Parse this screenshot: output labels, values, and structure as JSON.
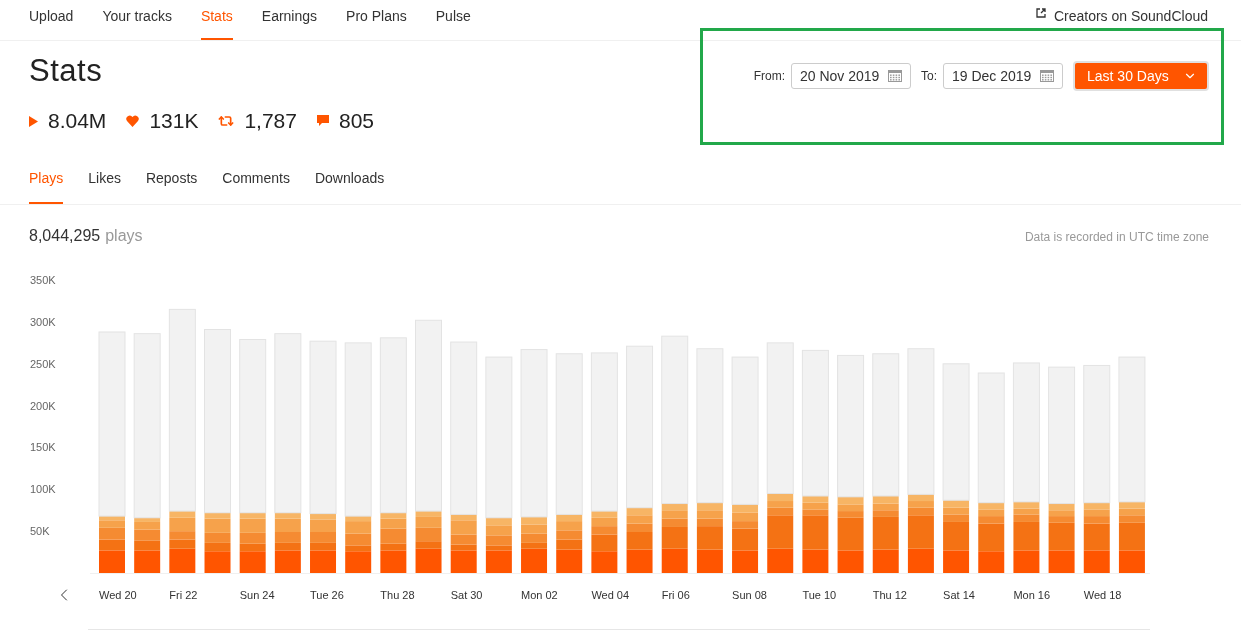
{
  "nav": {
    "items": [
      {
        "label": "Upload",
        "selected": false
      },
      {
        "label": "Your tracks",
        "selected": false
      },
      {
        "label": "Stats",
        "selected": true
      },
      {
        "label": "Earnings",
        "selected": false
      },
      {
        "label": "Pro Plans",
        "selected": false
      },
      {
        "label": "Pulse",
        "selected": false
      }
    ],
    "external_link": "Creators on SoundCloud"
  },
  "title": "Stats",
  "totals": [
    {
      "kind": "plays",
      "value": "8.04M"
    },
    {
      "kind": "likes",
      "value": "131K"
    },
    {
      "kind": "reposts",
      "value": "1,787"
    },
    {
      "kind": "comments",
      "value": "805"
    }
  ],
  "date_range": {
    "from_label": "From:",
    "from": "20 Nov 2019",
    "to_label": "To:",
    "to": "19 Dec 2019",
    "preset": "Last 30 Days"
  },
  "tabs": [
    {
      "label": "Plays",
      "selected": true
    },
    {
      "label": "Likes",
      "selected": false
    },
    {
      "label": "Reposts",
      "selected": false
    },
    {
      "label": "Comments",
      "selected": false
    },
    {
      "label": "Downloads",
      "selected": false
    }
  ],
  "summary": {
    "count": "8,044,295",
    "unit": "plays",
    "note": "Data is recorded in UTC time zone"
  },
  "chart_data": {
    "type": "bar",
    "stacked": true,
    "categories": [
      "Wed 20",
      null,
      "Fri 22",
      null,
      "Sun 24",
      null,
      "Tue 26",
      null,
      "Thu 28",
      null,
      "Sat 30",
      null,
      "Mon 02",
      null,
      "Wed 04",
      null,
      "Fri 06",
      null,
      "Sun 08",
      null,
      "Tue 10",
      null,
      "Thu 12",
      null,
      "Sat 14",
      null,
      "Mon 16",
      null,
      "Wed 18",
      null
    ],
    "yticks": [
      {
        "value": 50,
        "label": "50K"
      },
      {
        "value": 100,
        "label": "100K"
      },
      {
        "value": 150,
        "label": "150K"
      },
      {
        "value": 200,
        "label": "200K"
      },
      {
        "value": 250,
        "label": "250K"
      },
      {
        "value": 300,
        "label": "300K"
      },
      {
        "value": 350,
        "label": "350K"
      }
    ],
    "ylim": [
      0,
      350
    ],
    "series": [
      {
        "color": "#ff5500",
        "values": [
          27,
          27,
          29,
          26,
          26,
          27,
          27,
          26,
          27,
          29,
          27,
          27,
          29,
          28,
          26,
          28,
          29,
          28,
          27,
          29,
          28,
          27,
          28,
          29,
          27,
          26,
          27,
          27,
          27,
          27
        ]
      },
      {
        "color": "#f47214",
        "values": [
          13,
          12,
          11,
          10,
          9,
          9,
          9,
          7,
          8,
          9,
          7,
          6,
          7,
          12,
          20,
          21,
          26,
          28,
          26,
          40,
          41,
          39,
          39,
          40,
          34,
          33,
          34,
          33,
          32,
          33
        ]
      },
      {
        "color": "#f58b32",
        "values": [
          14,
          13,
          10,
          12,
          13,
          13,
          13,
          14,
          18,
          16,
          12,
          12,
          11,
          11,
          10,
          10,
          10,
          9,
          9,
          9,
          7,
          8,
          8,
          9,
          9,
          9,
          9,
          8,
          9,
          9
        ]
      },
      {
        "color": "#f6a24b",
        "values": [
          9,
          9,
          16,
          17,
          17,
          16,
          15,
          15,
          12,
          13,
          17,
          12,
          11,
          11,
          10,
          10,
          10,
          10,
          10,
          8,
          8,
          8,
          8,
          8,
          8,
          8,
          7,
          7,
          8,
          8
        ]
      },
      {
        "color": "#f7b565",
        "values": [
          5,
          5,
          8,
          7,
          7,
          7,
          7,
          6,
          7,
          7,
          7,
          9,
          9,
          8,
          8,
          9,
          8,
          9,
          10,
          9,
          8,
          9,
          9,
          8,
          9,
          8,
          8,
          8,
          8,
          8
        ]
      },
      {
        "color": "#f2f2f2",
        "values": [
          220,
          220,
          241,
          219,
          207,
          214,
          206,
          207,
          209,
          228,
          206,
          192,
          200,
          192,
          189,
          193,
          200,
          184,
          176,
          180,
          174,
          169,
          170,
          174,
          163,
          155,
          166,
          163,
          164,
          173
        ]
      }
    ]
  }
}
